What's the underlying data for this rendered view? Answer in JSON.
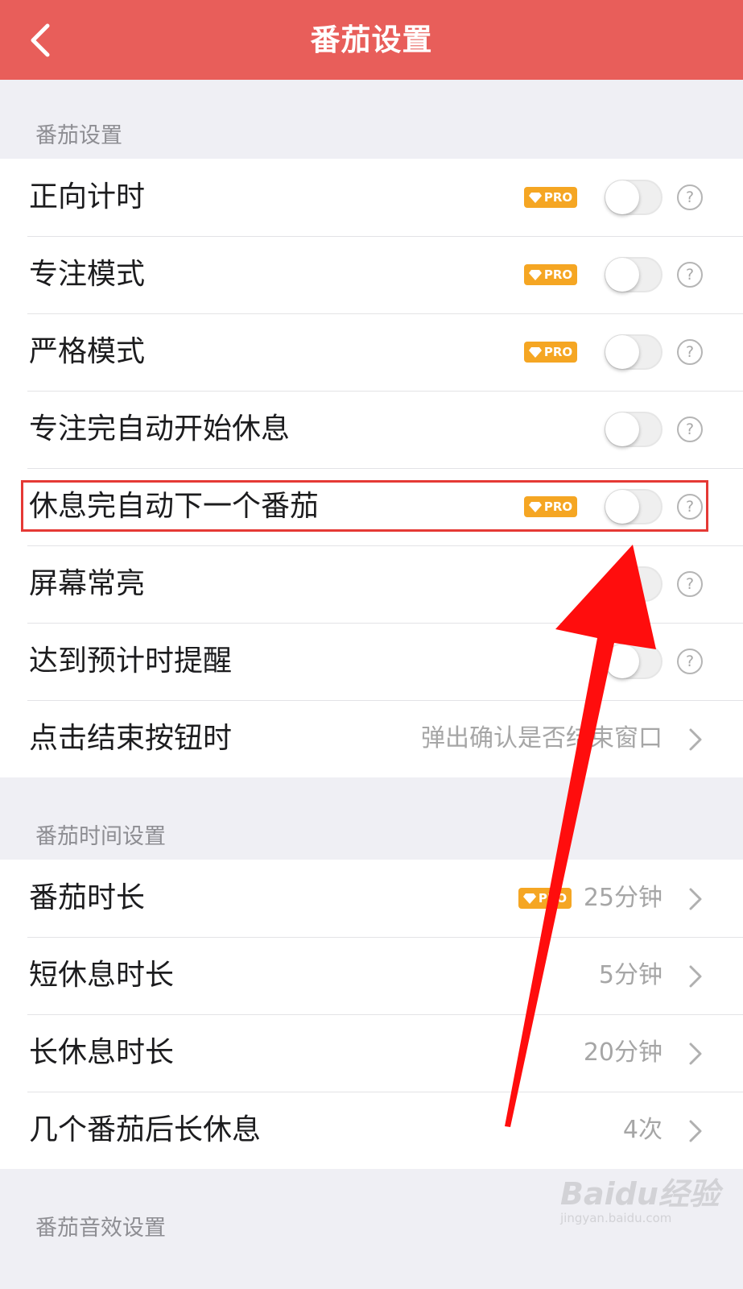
{
  "header": {
    "title": "番茄设置",
    "back_icon": "chevron-left-icon"
  },
  "sections": [
    {
      "label": "番茄设置",
      "rows": [
        {
          "label": "正向计时",
          "pro": true,
          "toggle_on": false,
          "help": true
        },
        {
          "label": "专注模式",
          "pro": true,
          "toggle_on": false,
          "help": true
        },
        {
          "label": "严格模式",
          "pro": true,
          "toggle_on": false,
          "help": true
        },
        {
          "label": "专注完自动开始休息",
          "pro": false,
          "toggle_on": false,
          "help": true
        },
        {
          "label": "休息完自动下一个番茄",
          "pro": true,
          "toggle_on": false,
          "help": true
        },
        {
          "label": "屏幕常亮",
          "pro": false,
          "toggle_on": false,
          "help": true
        },
        {
          "label": "达到预计时提醒",
          "pro": false,
          "toggle_on": false,
          "help": true
        },
        {
          "label": "点击结束按钮时",
          "value": "弹出确认是否结束窗口"
        }
      ]
    },
    {
      "label": "番茄时间设置",
      "rows": [
        {
          "label": "番茄时长",
          "pro": true,
          "value": "25分钟"
        },
        {
          "label": "短休息时长",
          "value": "5分钟"
        },
        {
          "label": "长休息时长",
          "value": "20分钟"
        },
        {
          "label": "几个番茄后长休息",
          "value": "4次"
        }
      ]
    },
    {
      "label": "番茄音效设置"
    }
  ],
  "badge": {
    "text": "PRO",
    "icon": "diamond-icon",
    "color": "#f5a623"
  },
  "help_glyph": "?",
  "colors": {
    "header": "#e85e5a",
    "annotation": "#e53935",
    "background": "#efeff4"
  },
  "watermark": {
    "main": "Baidu经验",
    "sub": "jingyan.baidu.com"
  }
}
